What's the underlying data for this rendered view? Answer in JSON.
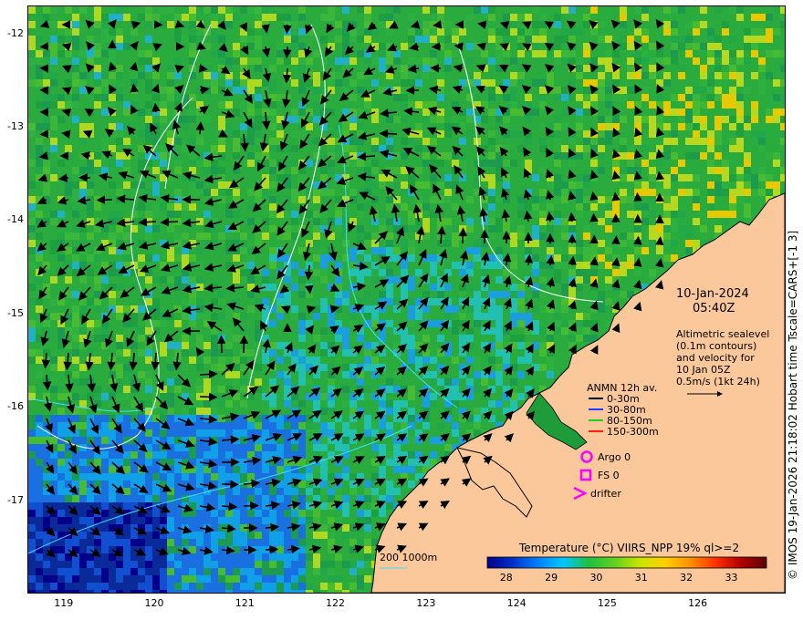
{
  "axes": {
    "x_ticks": [
      "119",
      "120",
      "121",
      "122",
      "123",
      "124",
      "125",
      "126"
    ],
    "y_ticks": [
      "-12",
      "-13",
      "-14",
      "-15",
      "-16",
      "-17"
    ],
    "lon_range": [
      118.6,
      126.95
    ],
    "lat_range": [
      -17.98,
      -11.7
    ]
  },
  "timestamp": {
    "date": "10-Jan-2024",
    "time": "05:40Z"
  },
  "description": {
    "line1": "Altimetric sealevel",
    "line2": "(0.1m contours)",
    "line3": "and velocity for",
    "line4": "10 Jan 05Z",
    "scale": "0.5m/s (1kt 24h)"
  },
  "legend": {
    "title": "ANMN 12h av.",
    "items": [
      {
        "label": "0-30m",
        "color": "#000000"
      },
      {
        "label": "30-80m",
        "color": "#1e3cff"
      },
      {
        "label": "80-150m",
        "color": "#22cc22"
      },
      {
        "label": "150-300m",
        "color": "#ff2200"
      }
    ],
    "argo": "Argo 0",
    "fs": "FS 0",
    "drifter": "drifter",
    "marker_color": "#ff00ff"
  },
  "depth_contours": {
    "label": "200  1000m",
    "color": "#40e0ff"
  },
  "colorbar": {
    "title": "Temperature (°C) VIIRS_NPP 19% ql>=2",
    "ticks": [
      "28",
      "29",
      "30",
      "31",
      "32",
      "33"
    ],
    "range": [
      27.6,
      33.8
    ],
    "colors": [
      "#00008b",
      "#0030c8",
      "#0080ff",
      "#00c8ff",
      "#20c040",
      "#60d020",
      "#c8e400",
      "#ffd000",
      "#ff9000",
      "#ff3000",
      "#b00000",
      "#5a0000"
    ]
  },
  "credit": "© IMOS 19-Jan-2026 21:18:02 Hobart time Tscale=CARS+[-1 3]",
  "colors": {
    "land": "#fac89b",
    "frame": "#000000"
  }
}
